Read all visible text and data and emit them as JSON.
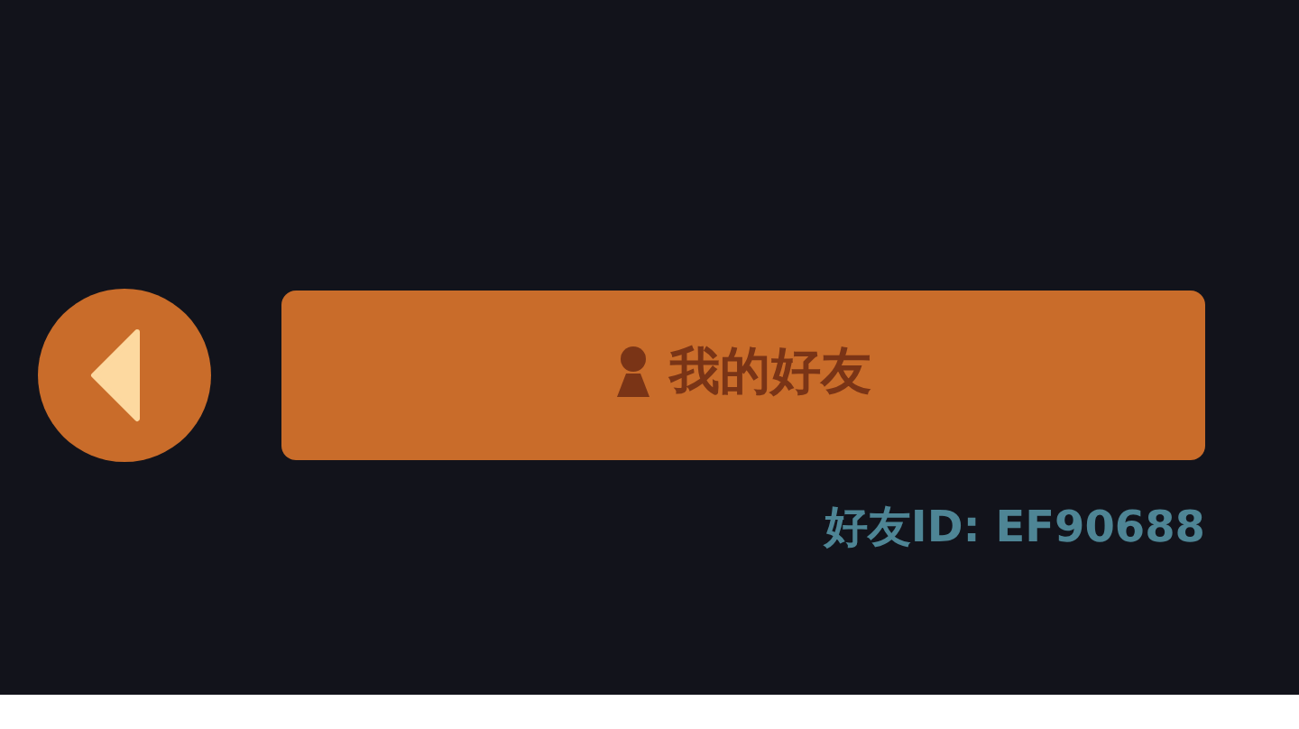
{
  "friends_button": {
    "label": "我的好友"
  },
  "friend_id": "好友ID: EF90688"
}
